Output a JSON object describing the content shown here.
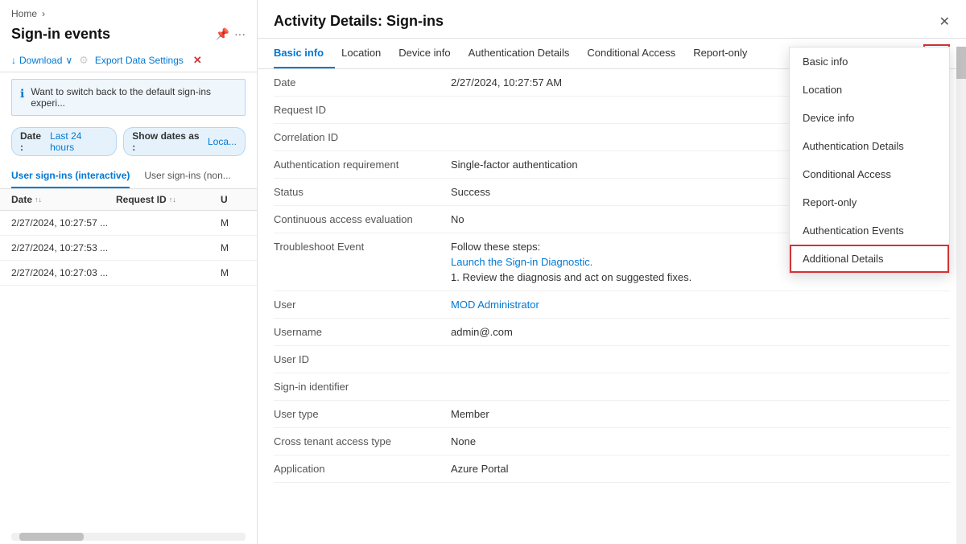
{
  "left": {
    "breadcrumb": "Home",
    "breadcrumb_arrow": "›",
    "title": "Sign-in events",
    "pin_icon": "📌",
    "more_icon": "···",
    "toolbar": {
      "download": "Download",
      "download_chevron": "∨",
      "export": "Export Data Settings",
      "close_icon": "✕"
    },
    "info_bar": "Want to switch back to the default sign-ins experi...",
    "filter_chips": [
      {
        "label": "Date",
        "value": "Last 24 hours"
      },
      {
        "label": "Show dates as",
        "value": "Loca..."
      }
    ],
    "tabs": [
      {
        "label": "User sign-ins (interactive)",
        "active": true
      },
      {
        "label": "User sign-ins (non...",
        "active": false
      }
    ],
    "table_headers": [
      {
        "label": "Date",
        "sort": "↑↓"
      },
      {
        "label": "Request ID",
        "sort": "↑↓"
      },
      {
        "label": "U",
        "sort": ""
      }
    ],
    "rows": [
      {
        "date": "2/27/2024, 10:27:57 ...",
        "reqid": "",
        "u": "M"
      },
      {
        "date": "2/27/2024, 10:27:53 ...",
        "reqid": "",
        "u": "M"
      },
      {
        "date": "2/27/2024, 10:27:03 ...",
        "reqid": "",
        "u": "M"
      }
    ]
  },
  "right": {
    "title": "Activity Details: Sign-ins",
    "close_icon": "✕",
    "nav_tabs": [
      {
        "label": "Basic info",
        "active": true
      },
      {
        "label": "Location",
        "active": false
      },
      {
        "label": "Device info",
        "active": false
      },
      {
        "label": "Authentication Details",
        "active": false
      },
      {
        "label": "Conditional Access",
        "active": false
      },
      {
        "label": "Report-only",
        "active": false
      }
    ],
    "more_btn_label": "···",
    "fields": [
      {
        "label": "Date",
        "value": "2/27/2024, 10:27:57 AM",
        "type": "text"
      },
      {
        "label": "Request ID",
        "value": "",
        "type": "text"
      },
      {
        "label": "Correlation ID",
        "value": "",
        "type": "text"
      },
      {
        "label": "Authentication requirement",
        "value": "Single-factor authentication",
        "type": "text"
      },
      {
        "label": "Status",
        "value": "Success",
        "type": "text"
      },
      {
        "label": "Continuous access evaluation",
        "value": "No",
        "type": "text"
      },
      {
        "label": "Troubleshoot Event",
        "value": "",
        "type": "troubleshoot"
      },
      {
        "label": "User",
        "value": "MOD Administrator",
        "type": "link"
      },
      {
        "label": "Username",
        "value": "admin@.com",
        "type": "text"
      },
      {
        "label": "User ID",
        "value": "",
        "type": "text"
      },
      {
        "label": "Sign-in identifier",
        "value": "",
        "type": "text"
      },
      {
        "label": "User type",
        "value": "Member",
        "type": "text"
      },
      {
        "label": "Cross tenant access type",
        "value": "None",
        "type": "text"
      },
      {
        "label": "Application",
        "value": "Azure Portal",
        "type": "text"
      }
    ],
    "troubleshoot": {
      "follow": "Follow these steps:",
      "link": "Launch the Sign-in Diagnostic.",
      "step1": "1. Review the diagnosis and act on suggested fixes."
    },
    "dropdown": {
      "items": [
        {
          "label": "Basic info",
          "highlighted": false
        },
        {
          "label": "Location",
          "highlighted": false
        },
        {
          "label": "Device info",
          "highlighted": false
        },
        {
          "label": "Authentication Details",
          "highlighted": false
        },
        {
          "label": "Conditional Access",
          "highlighted": false
        },
        {
          "label": "Report-only",
          "highlighted": false
        },
        {
          "label": "Authentication Events",
          "highlighted": false
        },
        {
          "label": "Additional Details",
          "highlighted": true
        }
      ]
    }
  }
}
